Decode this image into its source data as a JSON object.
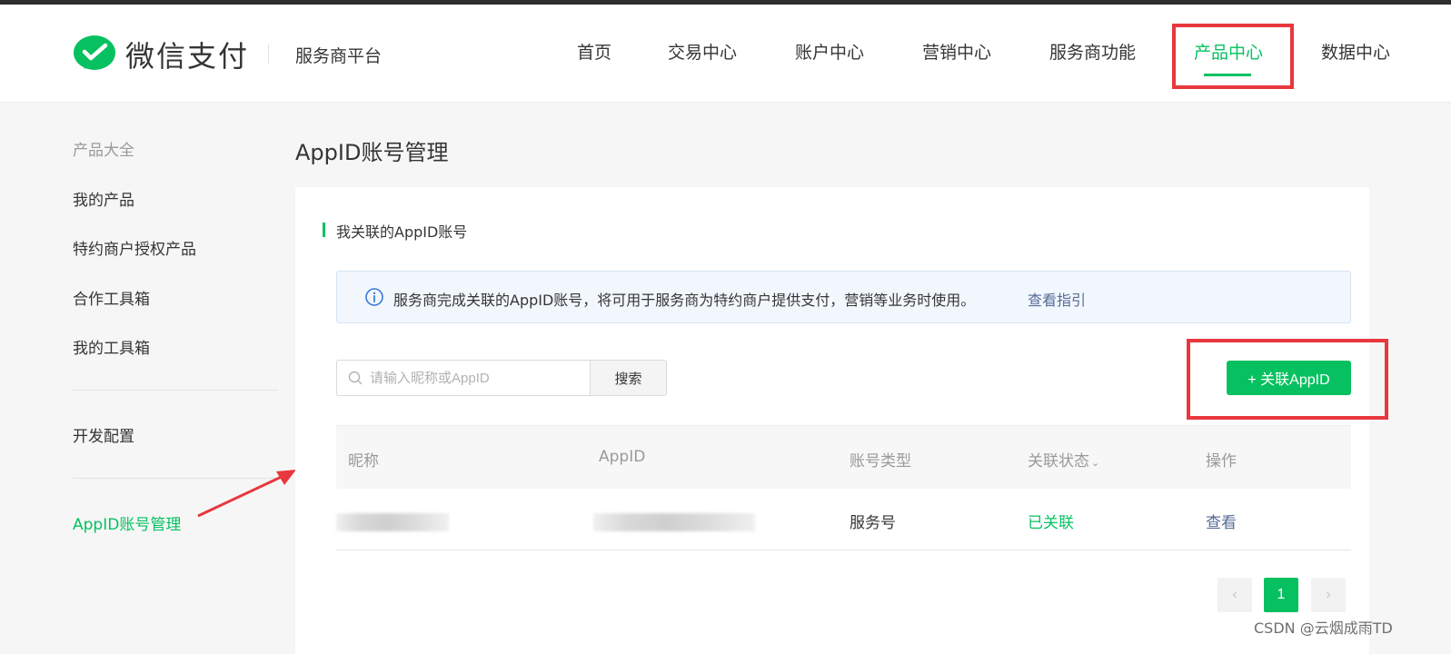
{
  "header": {
    "brand": "微信支付",
    "platform": "服务商平台",
    "nav": [
      "首页",
      "交易中心",
      "账户中心",
      "营销中心",
      "服务商功能",
      "产品中心",
      "数据中心"
    ],
    "active_nav": "产品中心"
  },
  "sidebar": {
    "section_label": "产品大全",
    "items": [
      "我的产品",
      "特约商户授权产品",
      "合作工具箱",
      "我的工具箱"
    ],
    "dev_config": "开发配置",
    "active_item": "AppID账号管理"
  },
  "main": {
    "title": "AppID账号管理",
    "section_title": "我关联的AppID账号",
    "notice_text": "服务商完成关联的AppID账号，将可用于服务商为特约商户提供支付，营销等业务时使用。",
    "notice_link": "查看指引",
    "search_placeholder": "请输入昵称或AppID",
    "search_button": "搜索",
    "add_button": "+ 关联AppID",
    "table": {
      "columns": [
        "昵称",
        "AppID",
        "账号类型",
        "关联状态",
        "操作"
      ],
      "rows": [
        {
          "account_type": "服务号",
          "status": "已关联",
          "action": "查看"
        }
      ]
    },
    "pagination": {
      "current": "1",
      "prev": "‹",
      "next": "›"
    }
  },
  "watermark": "CSDN @云烟成雨TD",
  "colors": {
    "accent": "#07c160",
    "link": "#576b95",
    "highlight": "#e8383d"
  }
}
